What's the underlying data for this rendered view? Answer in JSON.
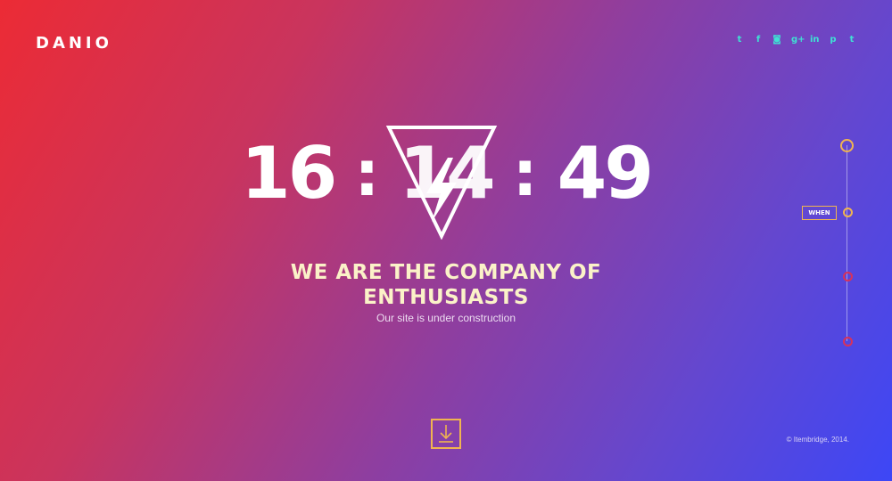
{
  "brand": {
    "logo": "DANIO"
  },
  "social": {
    "icons": [
      {
        "name": "twitter-icon",
        "glyph": "t"
      },
      {
        "name": "facebook-icon",
        "glyph": "f"
      },
      {
        "name": "instagram-icon",
        "glyph": "◙"
      },
      {
        "name": "google-plus-icon",
        "glyph": "g+"
      },
      {
        "name": "linkedin-icon",
        "glyph": "in"
      },
      {
        "name": "pinterest-icon",
        "glyph": "p"
      },
      {
        "name": "tumblr-icon",
        "glyph": "t"
      }
    ],
    "color": "#3fe0d4"
  },
  "clock": {
    "hours": "16",
    "minutes": "14",
    "seconds": "49",
    "separator": ":"
  },
  "hero": {
    "headline_line1": "WE ARE THE COMPANY OF",
    "headline_line2": "ENTHUSIASTS",
    "subtitle": "Our site is under construction"
  },
  "timeline": {
    "active_label": "WHEN"
  },
  "footer": {
    "copyright": "© Itembridge, 2014."
  },
  "colors": {
    "gradient_start": "#ec2b35",
    "gradient_end": "#3d47f6",
    "accent": "#f0b450",
    "headline": "#fbf2c8"
  }
}
